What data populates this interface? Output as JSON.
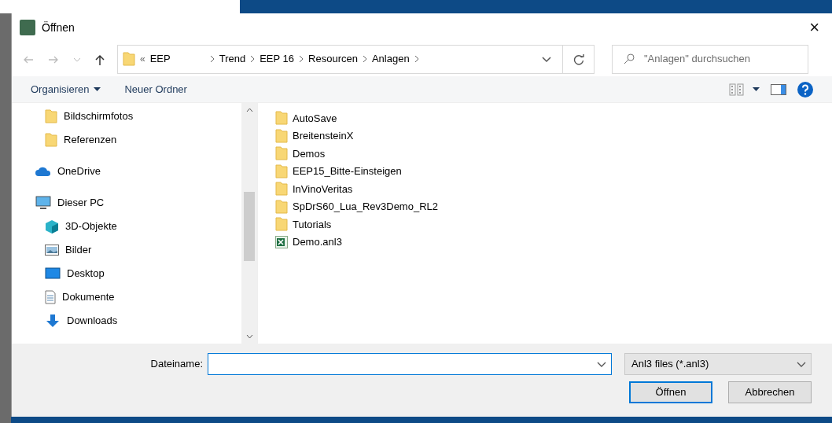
{
  "window": {
    "title": "Öffnen",
    "close": "×"
  },
  "address_bar": {
    "overflow_mark": "«",
    "crumbs": [
      "EEP",
      "Trend",
      "EEP 16",
      "Resourcen",
      "Anlagen"
    ]
  },
  "search": {
    "placeholder": "\"Anlagen\" durchsuchen"
  },
  "toolbar": {
    "buttons": [
      "Organisieren",
      "Neuer Ordner"
    ]
  },
  "nav": {
    "under_hidden_parent": [
      {
        "label": "Bildschirmfotos",
        "kind": "folder"
      },
      {
        "label": "Referenzen",
        "kind": "folder"
      }
    ],
    "items": [
      {
        "label": "OneDrive",
        "kind": "cloud"
      },
      {
        "label": "Dieser PC",
        "kind": "pc",
        "children": [
          {
            "label": "3D-Objekte",
            "kind": "cube"
          },
          {
            "label": "Bilder",
            "kind": "pictures"
          },
          {
            "label": "Desktop",
            "kind": "desktop"
          },
          {
            "label": "Dokumente",
            "kind": "documents"
          },
          {
            "label": "Downloads",
            "kind": "downloads"
          }
        ]
      }
    ]
  },
  "files": [
    {
      "name": "AutoSave",
      "kind": "folder"
    },
    {
      "name": "BreitensteinX",
      "kind": "folder"
    },
    {
      "name": "Demos",
      "kind": "folder"
    },
    {
      "name": "EEP15_Bitte-Einsteigen",
      "kind": "folder"
    },
    {
      "name": "InVinoVeritas",
      "kind": "folder"
    },
    {
      "name": "SpDrS60_Lua_Rev3Demo_RL2",
      "kind": "folder"
    },
    {
      "name": "Tutorials",
      "kind": "folder"
    },
    {
      "name": "Demo.anl3",
      "kind": "spreadsheet"
    }
  ],
  "filename": {
    "label": "Dateiname:"
  },
  "filetype": {
    "value": "Anl3 files (*.anl3)"
  },
  "buttons": [
    {
      "label": "Öffnen",
      "primary": true
    },
    {
      "label": "Abbrechen",
      "primary": false
    }
  ]
}
